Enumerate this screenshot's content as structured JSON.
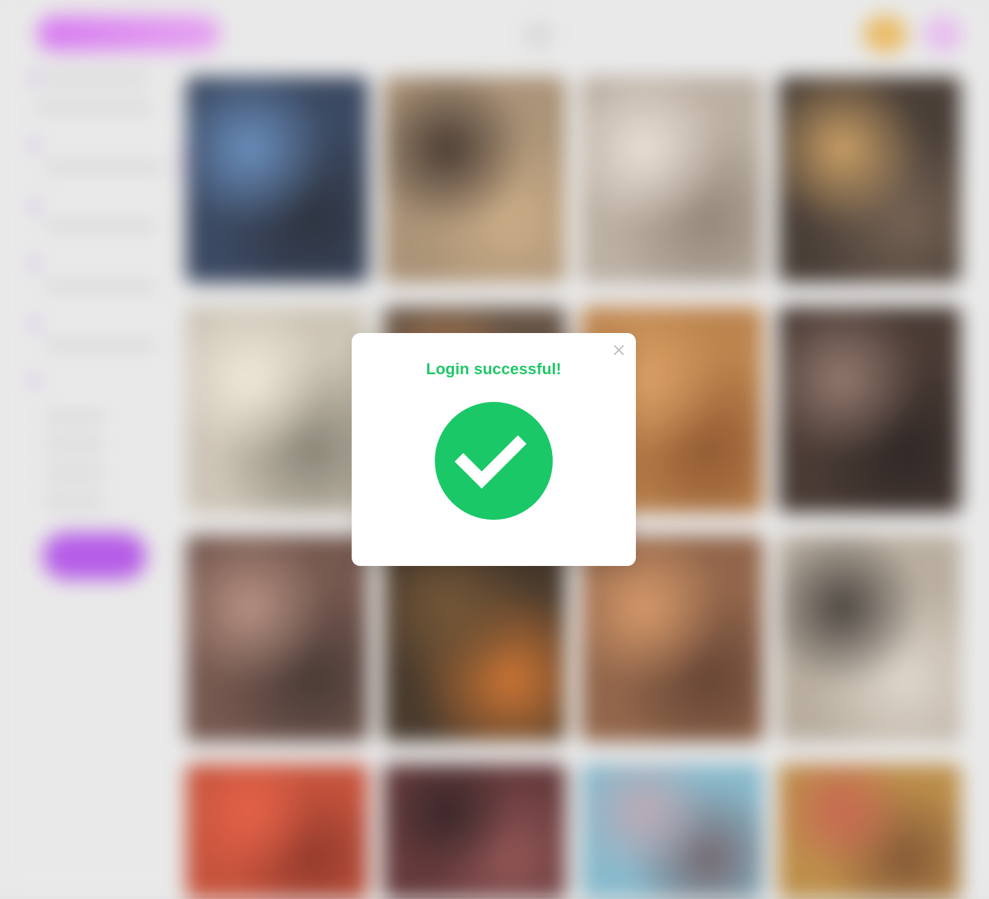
{
  "colors": {
    "success": "#1ac868",
    "modal_bg": "#ffffff",
    "backdrop": "#e6e6e6",
    "brand_gradient_start": "#d46ff0",
    "brand_gradient_end": "#e49bf0",
    "primary_button": "#b04fe6"
  },
  "modal": {
    "title": "Login successful!",
    "close_icon": "close-icon",
    "status_icon": "checkmark-circle-icon"
  },
  "background": {
    "header": {
      "logo_icon": "brand-logo",
      "coins_icon": "coins-badge",
      "avatar_icon": "user-avatar"
    },
    "gallery": {
      "tiles": [
        {
          "colors": [
            "#2b3a55",
            "#5e86b8",
            "#1d2330"
          ]
        },
        {
          "colors": [
            "#a48a6c",
            "#3a2b22",
            "#c7a67c"
          ]
        },
        {
          "colors": [
            "#b7aa9c",
            "#e9ddd2",
            "#8c7e70"
          ]
        },
        {
          "colors": [
            "#3b2f27",
            "#c99a5a",
            "#6a5646"
          ]
        },
        {
          "colors": [
            "#c9c0b0",
            "#efe7d7",
            "#7f7a6a"
          ]
        },
        {
          "colors": [
            "#5a4636",
            "#b97a3e",
            "#2c1f18"
          ]
        },
        {
          "colors": [
            "#b87a3f",
            "#d79a5a",
            "#8a4d21"
          ]
        },
        {
          "colors": [
            "#3b2b24",
            "#8c6f63",
            "#1f1614"
          ]
        },
        {
          "colors": [
            "#6a4a40",
            "#b08878",
            "#3a2a25"
          ]
        },
        {
          "colors": [
            "#3a2a1c",
            "#6b4a26",
            "#c96a22"
          ]
        },
        {
          "colors": [
            "#8a5a3c",
            "#d4915e",
            "#5a3624"
          ]
        },
        {
          "colors": [
            "#b4a898",
            "#3c3530",
            "#ddd4c8"
          ]
        },
        {
          "colors": [
            "#c2452c",
            "#e4563a",
            "#8a2a1c"
          ]
        },
        {
          "colors": [
            "#5a2a2c",
            "#2a1618",
            "#8a4848"
          ]
        },
        {
          "colors": [
            "#7fb4c8",
            "#b9a2ae",
            "#6a5a62"
          ]
        },
        {
          "colors": [
            "#b8863c",
            "#c45a44",
            "#7a4a26"
          ]
        }
      ]
    }
  }
}
